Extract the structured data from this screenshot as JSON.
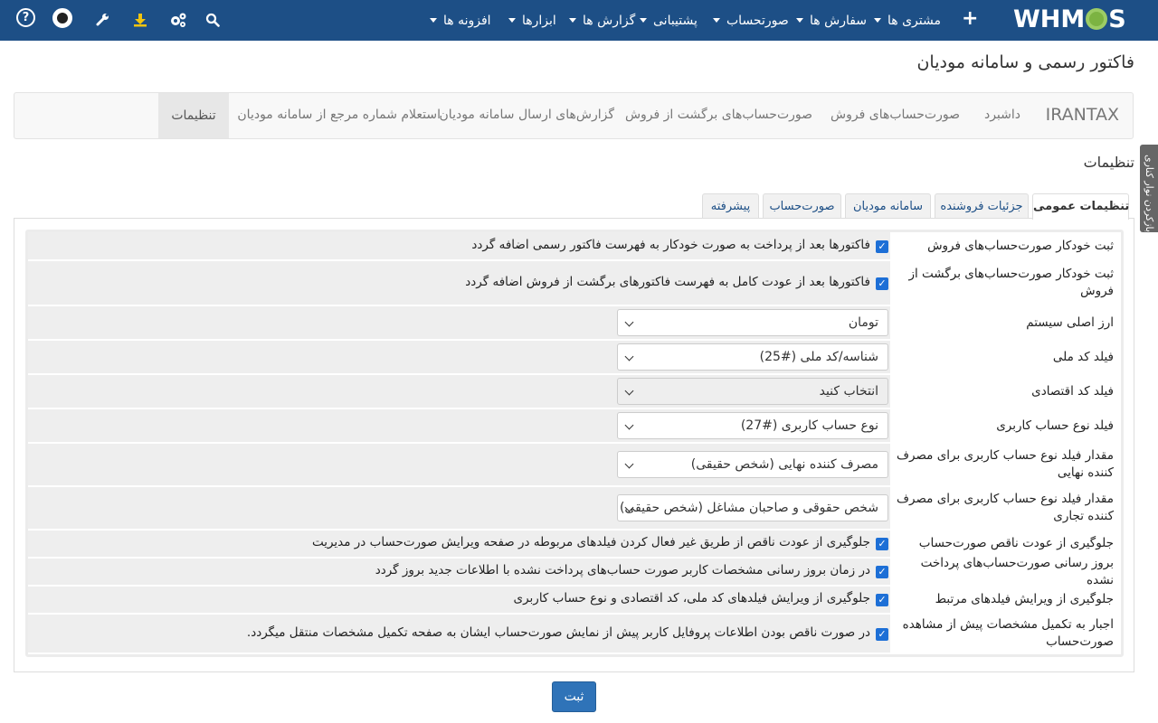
{
  "topbar": {
    "logo": "WHMCS",
    "logo_left": "WHM",
    "logo_right": "S",
    "menus": [
      {
        "label": "مشتری ها"
      },
      {
        "label": "سفارش ها"
      },
      {
        "label": "صورتحساب"
      },
      {
        "label": "پشتیبانی"
      },
      {
        "label": "گزارش ها"
      },
      {
        "label": "ابزارها"
      },
      {
        "label": "افزونه ها"
      }
    ],
    "icons": [
      "plus-icon",
      "search-icon",
      "cogs-icon",
      "download-icon",
      "wrench-icon",
      "avatar",
      "help-icon"
    ]
  },
  "page": {
    "title": "فاکتور رسمی و سامانه مودیان"
  },
  "module_nav": {
    "brand": "IRANTAX",
    "items": [
      "داشبرد",
      "صورت‌حساب‌های فروش",
      "صورت‌حساب‌های برگشت از فروش",
      "گزارش‌های ارسال سامانه مودیان",
      "استعلام شماره مرجع از سامانه مودیان",
      "تنظیمات"
    ],
    "active": "تنظیمات"
  },
  "section": {
    "title": "تنظیمات"
  },
  "side_toggle": {
    "label": "بازکردن نوار کناری"
  },
  "tabs": [
    "تنظیمات عمومی",
    "جزئیات فروشنده",
    "سامانه مودیان",
    "صورت‌حساب",
    "پیشرفته"
  ],
  "form": {
    "rows": [
      {
        "label": "ثبت خودکار صورت‌حساب‌های فروش",
        "type": "checkbox",
        "checked": true,
        "text": "فاکتورها بعد از پرداخت به صورت خودکار به فهرست فاکتور رسمی اضافه گردد"
      },
      {
        "label": "ثبت خودکار صورت‌حساب‌های برگشت از فروش",
        "type": "checkbox",
        "checked": true,
        "text": "فاکتورها بعد از عودت کامل به فهرست فاکتورهای برگشت از فروش اضافه گردد"
      },
      {
        "label": "ارز اصلی سیستم",
        "type": "select",
        "value": "تومان"
      },
      {
        "label": "فیلد کد ملی",
        "type": "select",
        "value": "شناسه/کد ملی (#25)"
      },
      {
        "label": "فیلد کد اقتصادی",
        "type": "select",
        "value": "انتخاب کنید",
        "disabled": true
      },
      {
        "label": "فیلد نوع حساب کاربری",
        "type": "select",
        "value": "نوع حساب کاربری (#27)"
      },
      {
        "label": "مقدار فیلد نوع حساب کاربری برای مصرف کننده نهایی",
        "type": "select",
        "value": "مصرف کننده نهایی (شخص حقیقی)"
      },
      {
        "label": "مقدار فیلد نوع حساب کاربری برای مصرف کننده تجاری",
        "type": "select",
        "value": "شخص حقوقی و صاحبان مشاغل (شخص حقیقی)"
      },
      {
        "label": "جلوگیری از عودت ناقص صورت‌حساب",
        "type": "checkbox",
        "checked": true,
        "text": "جلوگیری از عودت ناقص از طریق غیر فعال کردن فیلدهای مربوطه در صفحه ویرایش صورت‌حساب در مدیریت"
      },
      {
        "label": "بروز رسانی صورت‌حساب‌های پرداخت نشده",
        "type": "checkbox",
        "checked": true,
        "text": "در زمان بروز رسانی مشخصات کاربر صورت حساب‌های پرداخت نشده با اطلاعات جدید بروز گردد"
      },
      {
        "label": "جلوگیری از ویرایش فیلدهای مرتبط",
        "type": "checkbox",
        "checked": true,
        "text": "جلوگیری از ویرایش فیلدهای کد ملی، کد اقتصادی و نوع حساب کاربری"
      },
      {
        "label": "اجبار به تکمیل مشخصات پیش از مشاهده صورت‌حساب",
        "type": "checkbox",
        "checked": true,
        "text": "در صورت ناقص بودن اطلاعات پروفایل کاربر پیش از نمایش صورت‌حساب ایشان به صفحه تکمیل مشخصات منتقل میگردد."
      }
    ],
    "save_label": "ثبت"
  },
  "colors": {
    "topbar": "#1d4f86",
    "checkbox": "#1d6fd6",
    "save_button": "#2f73b8",
    "logo_gear": "#7cb342"
  }
}
